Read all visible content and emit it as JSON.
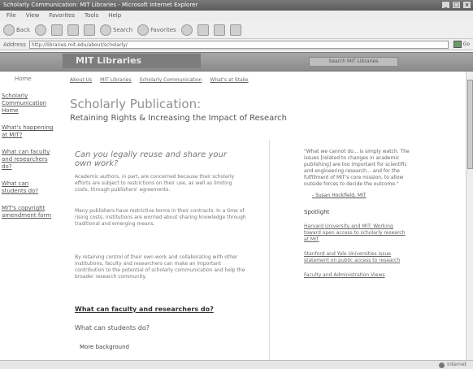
{
  "window": {
    "title": "Scholarly Communication: MIT Libraries - Microsoft Internet Explorer",
    "controls": [
      "_",
      "□",
      "×"
    ]
  },
  "menu": [
    "File",
    "View",
    "Favorites",
    "Tools",
    "Help"
  ],
  "toolbar": {
    "back": "Back",
    "search": "Search",
    "favorites": "Favorites"
  },
  "address": {
    "label": "Address",
    "url": "http://libraries.mit.edu/about/scholarly/",
    "go": "Go"
  },
  "banner": {
    "logo": "MIT Libraries",
    "search": "Search MIT Libraries"
  },
  "leftnav": [
    "Home",
    "Scholarly Communication Home",
    "What's happening at MIT?",
    "What can faculty and researchers do?",
    "What can students do?",
    "MIT's copyright amendment form"
  ],
  "breadcrumb": [
    "About Us",
    "MIT Libraries",
    "Scholarly Communication",
    "What's at Stake"
  ],
  "page": {
    "title": "Scholarly Publication:",
    "subtitle": "Retaining Rights & Increasing the Impact of Research",
    "question": "Can you legally reuse and share your own work?",
    "paragraphs": [
      "Academic authors, in part, are concerned because their scholarly efforts are subject to restrictions on their use, as well as limiting costs, through publishers' agreements.",
      "Many publishers have restrictive terms in their contracts. In a time of rising costs, institutions are worried about sharing knowledge through traditional and emerging means.",
      "By retaining control of their own work and collaborating with other institutions, faculty and researchers can make an important contribution to the potential of scholarly communication and help the broader research community."
    ],
    "link1": "What can faculty and researchers do?",
    "link2": "What can students do?",
    "link3": "More background"
  },
  "sidebar": {
    "quote": "\"What we cannot do... is simply watch. The issues [related to changes in academic publishing] are too important for scientific and engineering research... and for the fulfillment of MIT's core mission, to allow outside forces to decide the outcome.\"",
    "attribution": "- Susan Hockfield, MIT",
    "spotlight_title": "Spotlight",
    "spotlight_items": [
      "Harvard University and MIT: Working toward open access to scholarly research at MIT",
      "Stanford and Yale Universities issue statement on public access to research",
      "Faculty and Administration Views"
    ]
  },
  "status": {
    "zone": "Internet"
  }
}
